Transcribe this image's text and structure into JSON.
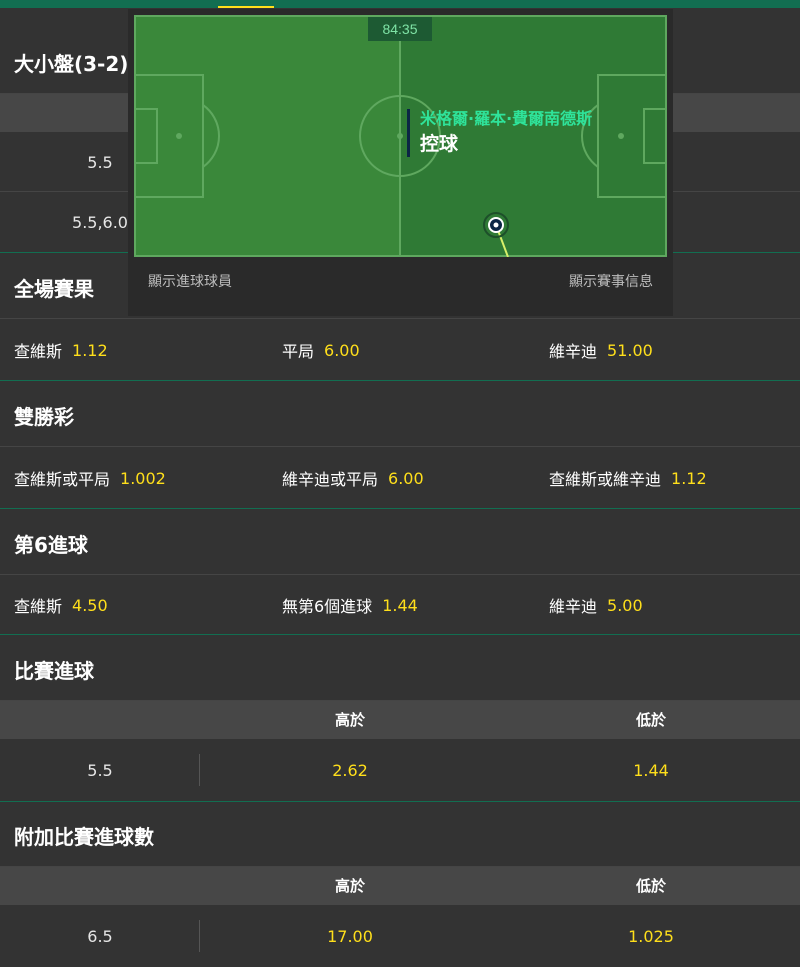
{
  "overlay": {
    "clock": "84:35",
    "player": "米格爾·羅本·費爾南德斯",
    "state": "控球",
    "link_left": "顯示進球球員",
    "link_right": "顯示賽事信息"
  },
  "total_sets": {
    "title": "大小盤(3-2)",
    "rows": [
      {
        "line": "5.5"
      },
      {
        "line": "5.5,6.0"
      }
    ]
  },
  "fulltime": {
    "title": "全場賽果",
    "outcomes": [
      {
        "label": "查維斯",
        "odd": "1.12"
      },
      {
        "label": "平局",
        "odd": "6.00"
      },
      {
        "label": "維辛迪",
        "odd": "51.00"
      }
    ]
  },
  "double_chance": {
    "title": "雙勝彩",
    "outcomes": [
      {
        "label": "查維斯或平局",
        "odd": "1.002"
      },
      {
        "label": "維辛迪或平局",
        "odd": "6.00"
      },
      {
        "label": "查維斯或維辛迪",
        "odd": "1.12"
      }
    ]
  },
  "sixth_goal": {
    "title": "第6進球",
    "outcomes": [
      {
        "label": "查維斯",
        "odd": "4.50"
      },
      {
        "label": "無第6個進球",
        "odd": "1.44"
      },
      {
        "label": "維辛迪",
        "odd": "5.00"
      }
    ]
  },
  "match_goals": {
    "title": "比賽進球",
    "over_label": "高於",
    "under_label": "低於",
    "line": "5.5",
    "over": "2.62",
    "under": "1.44"
  },
  "alt_goals": {
    "title": "附加比賽進球數",
    "over_label": "高於",
    "under_label": "低於",
    "line": "6.5",
    "over": "17.00",
    "under": "1.025"
  },
  "colors": {
    "accent_green": "#126e51",
    "odds_yellow": "#ffdf1b",
    "pitch_green": "#3c8a3c",
    "player_green": "#2fe39a"
  }
}
